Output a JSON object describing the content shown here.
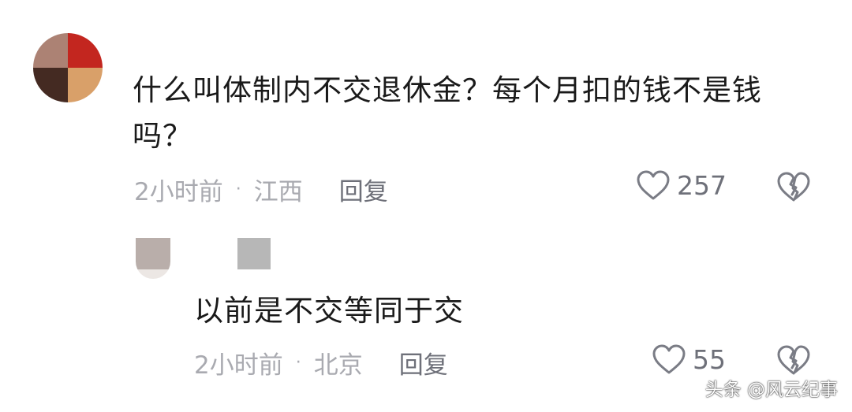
{
  "comment": {
    "text": "什么叫体制内不交退休金？每个月扣的钱不是钱吗？",
    "time": "2小时前",
    "separator": "·",
    "location": "江西",
    "reply_label": "回复",
    "likes": "257",
    "avatar_colors": [
      "#a87c6d",
      "#c01b14",
      "#3a1f17",
      "#d79b62"
    ]
  },
  "reply": {
    "text": "以前是不交等同于交",
    "time": "2小时前",
    "separator": "·",
    "location": "北京",
    "reply_label": "回复",
    "likes": "55"
  },
  "icons": {
    "like": "heart-outline-icon",
    "dislike": "broken-heart-icon"
  },
  "watermark": {
    "text": "头条 @风云纪事"
  }
}
